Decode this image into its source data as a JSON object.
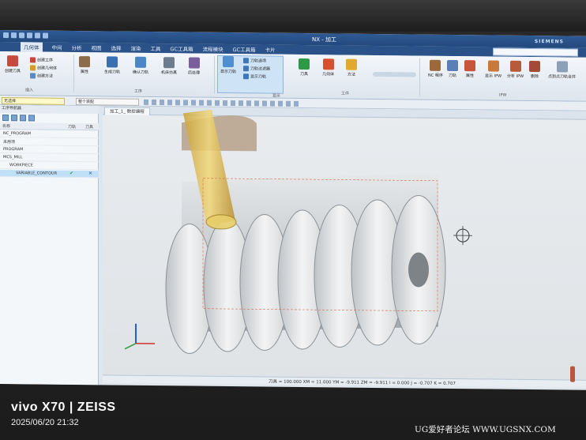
{
  "window": {
    "app_title": "NX - 加工",
    "brand": "SIEMENS"
  },
  "menubar": {
    "items": [
      {
        "label": "几何体",
        "active": true
      },
      {
        "label": "中间",
        "active": false
      },
      {
        "label": "分析",
        "active": false
      },
      {
        "label": "视图",
        "active": false
      },
      {
        "label": "选择",
        "active": false
      },
      {
        "label": "渲染",
        "active": false
      },
      {
        "label": "工具",
        "active": false
      },
      {
        "label": "GC工具箱",
        "active": false
      },
      {
        "label": "流程模块",
        "active": false
      },
      {
        "label": "GC工具箱",
        "active": false
      },
      {
        "label": "卡片",
        "active": false
      }
    ]
  },
  "ribbon": {
    "group1": {
      "buttons": [
        "创建刀具",
        "创建工序",
        "创建几何体",
        "创建方法"
      ],
      "label": "插入"
    },
    "group2": {
      "buttons": [
        "属性",
        "生成刀轨",
        "确认刀轨",
        "机床仿真",
        "后处理"
      ],
      "label": "工序"
    },
    "highlight_button": "显示刀轨",
    "group3": {
      "items": [
        "刀轨选项",
        "刀轨过滤器",
        "显示刀轨"
      ],
      "label": "显示"
    },
    "group4": {
      "buttons": [
        "刀具",
        "几何体",
        "方法"
      ],
      "label": "工件"
    },
    "group5": {
      "buttons": [
        "NC 程序",
        "刀轨",
        "属性",
        "显示 IPW",
        "分析 IPW",
        "删除",
        "点到点刀轨合并"
      ],
      "label": "IPW"
    }
  },
  "toolbar2": {
    "combo1": "无选择",
    "combo2": "整个装配"
  },
  "navigator": {
    "header": "工序导航器",
    "columns": [
      "名称",
      "刀轨",
      "刀具"
    ],
    "rows": [
      {
        "name": "NC_PROGRAM",
        "indent": 0,
        "selected": false
      },
      {
        "name": "未用项",
        "indent": 0,
        "selected": false
      },
      {
        "name": "PROGRAM",
        "indent": 0,
        "selected": false
      },
      {
        "name": "MCS_MILL",
        "indent": 0,
        "selected": false
      },
      {
        "name": "WORKPIECE",
        "indent": 1,
        "selected": false
      },
      {
        "name": "VARIABLE_CONTOUR",
        "indent": 2,
        "selected": true
      }
    ]
  },
  "document_tab": "加工_1_ 数控编程",
  "status": {
    "coords": "刀具 = 100.000  XM = 11.000  YM = -9.911  ZM = -9.911  I = 0.000  J = -0.707  K = 0.707"
  },
  "overlay": {
    "camera": "vivo X70 | ZEISS",
    "datetime": "2025/06/20 21:32",
    "forum": "UG爱好者论坛  WWW.UGSNX.COM"
  },
  "colors": {
    "title_bar": "#2f5a94",
    "tool_holder": "#e2c25a",
    "part": "#dadcdd",
    "spindle": "#b9a58f"
  }
}
